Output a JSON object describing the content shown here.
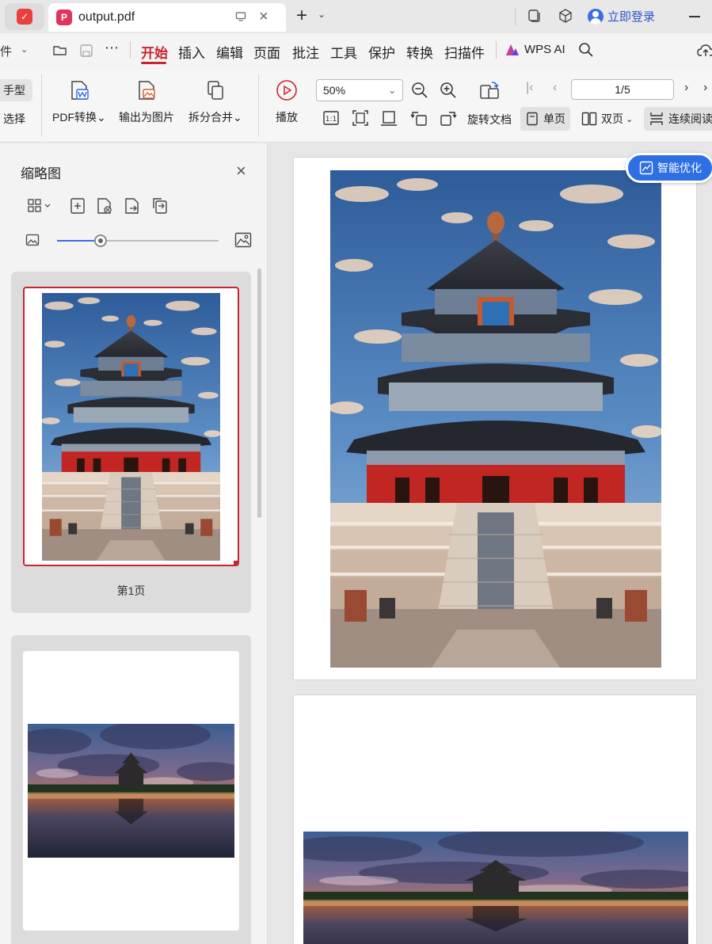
{
  "titlebar": {
    "tab_title": "output.pdf",
    "login_label": "立即登录"
  },
  "menubar": {
    "file_label": "件",
    "items": [
      "开始",
      "插入",
      "编辑",
      "页面",
      "批注",
      "工具",
      "保护",
      "转换",
      "扫描件"
    ],
    "active_item": "开始",
    "wps_ai_label": "WPS AI"
  },
  "ribbon": {
    "hand_label": "手型",
    "select_label": "选择",
    "pdf_convert_label": "PDF转换",
    "export_image_label": "输出为图片",
    "split_merge_label": "拆分合并",
    "play_label": "播放",
    "zoom_value": "50%",
    "rotate_doc_label": "旋转文档",
    "page_indicator": "1/5",
    "single_page_label": "单页",
    "double_page_label": "双页",
    "continuous_label": "连续阅读"
  },
  "thumbnail_panel": {
    "title": "缩略图",
    "zoom_level": 0.27,
    "pages": [
      {
        "label": "第1页",
        "selected": true
      },
      {
        "label": "",
        "selected": false
      }
    ]
  },
  "smart_optimize_label": "智能优化",
  "colors": {
    "accent_red": "#c8242f",
    "accent_blue": "#2f6fe4",
    "link_blue": "#2a56c6"
  }
}
